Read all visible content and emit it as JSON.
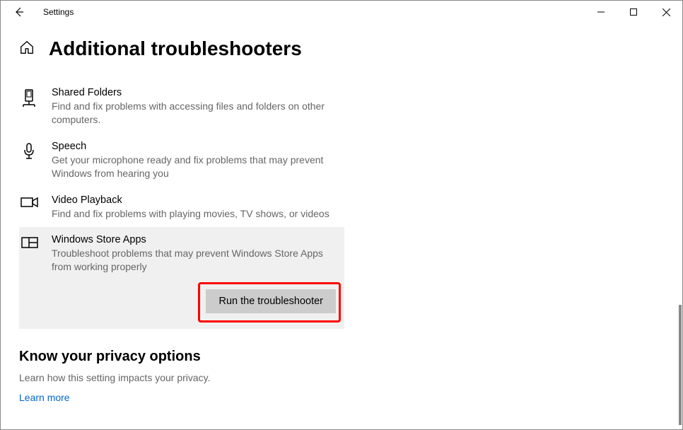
{
  "app": {
    "title": "Settings"
  },
  "page": {
    "title": "Additional troubleshooters"
  },
  "troubleshooters": [
    {
      "title": "Shared Folders",
      "desc": "Find and fix problems with accessing files and folders on other computers."
    },
    {
      "title": "Speech",
      "desc": "Get your microphone ready and fix problems that may prevent Windows from hearing you"
    },
    {
      "title": "Video Playback",
      "desc": "Find and fix problems with playing movies, TV shows, or videos"
    },
    {
      "title": "Windows Store Apps",
      "desc": "Troubleshoot problems that may prevent Windows Store Apps from working properly"
    }
  ],
  "action": {
    "run_label": "Run the troubleshooter"
  },
  "privacy": {
    "title": "Know your privacy options",
    "desc": "Learn how this setting impacts your privacy.",
    "link": "Learn more"
  }
}
